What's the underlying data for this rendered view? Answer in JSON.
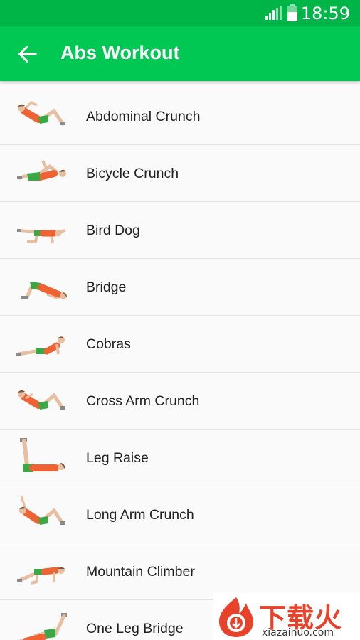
{
  "status_bar": {
    "time": "18:59"
  },
  "app_bar": {
    "title": "Abs Workout"
  },
  "exercises": [
    {
      "name": "Abdominal Crunch",
      "figure": "crunch-figure-icon"
    },
    {
      "name": "Bicycle Crunch",
      "figure": "bicycle-crunch-figure-icon"
    },
    {
      "name": "Bird Dog",
      "figure": "bird-dog-figure-icon"
    },
    {
      "name": "Bridge",
      "figure": "bridge-figure-icon"
    },
    {
      "name": "Cobras",
      "figure": "cobra-figure-icon"
    },
    {
      "name": "Cross Arm Crunch",
      "figure": "crunch-figure-icon"
    },
    {
      "name": "Leg Raise",
      "figure": "leg-raise-figure-icon"
    },
    {
      "name": "Long Arm Crunch",
      "figure": "crunch-figure-icon"
    },
    {
      "name": "Mountain Climber",
      "figure": "mountain-climber-figure-icon"
    },
    {
      "name": "One Leg Bridge",
      "figure": "one-leg-bridge-figure-icon"
    }
  ],
  "watermark": {
    "brand": "下载火",
    "url": "xiazaihuo.com"
  },
  "colors": {
    "primary": "#00c853",
    "status_bar": "#00b548",
    "shirt": "#ef6234",
    "shorts": "#3aa845",
    "skin": "#e8bea0"
  }
}
